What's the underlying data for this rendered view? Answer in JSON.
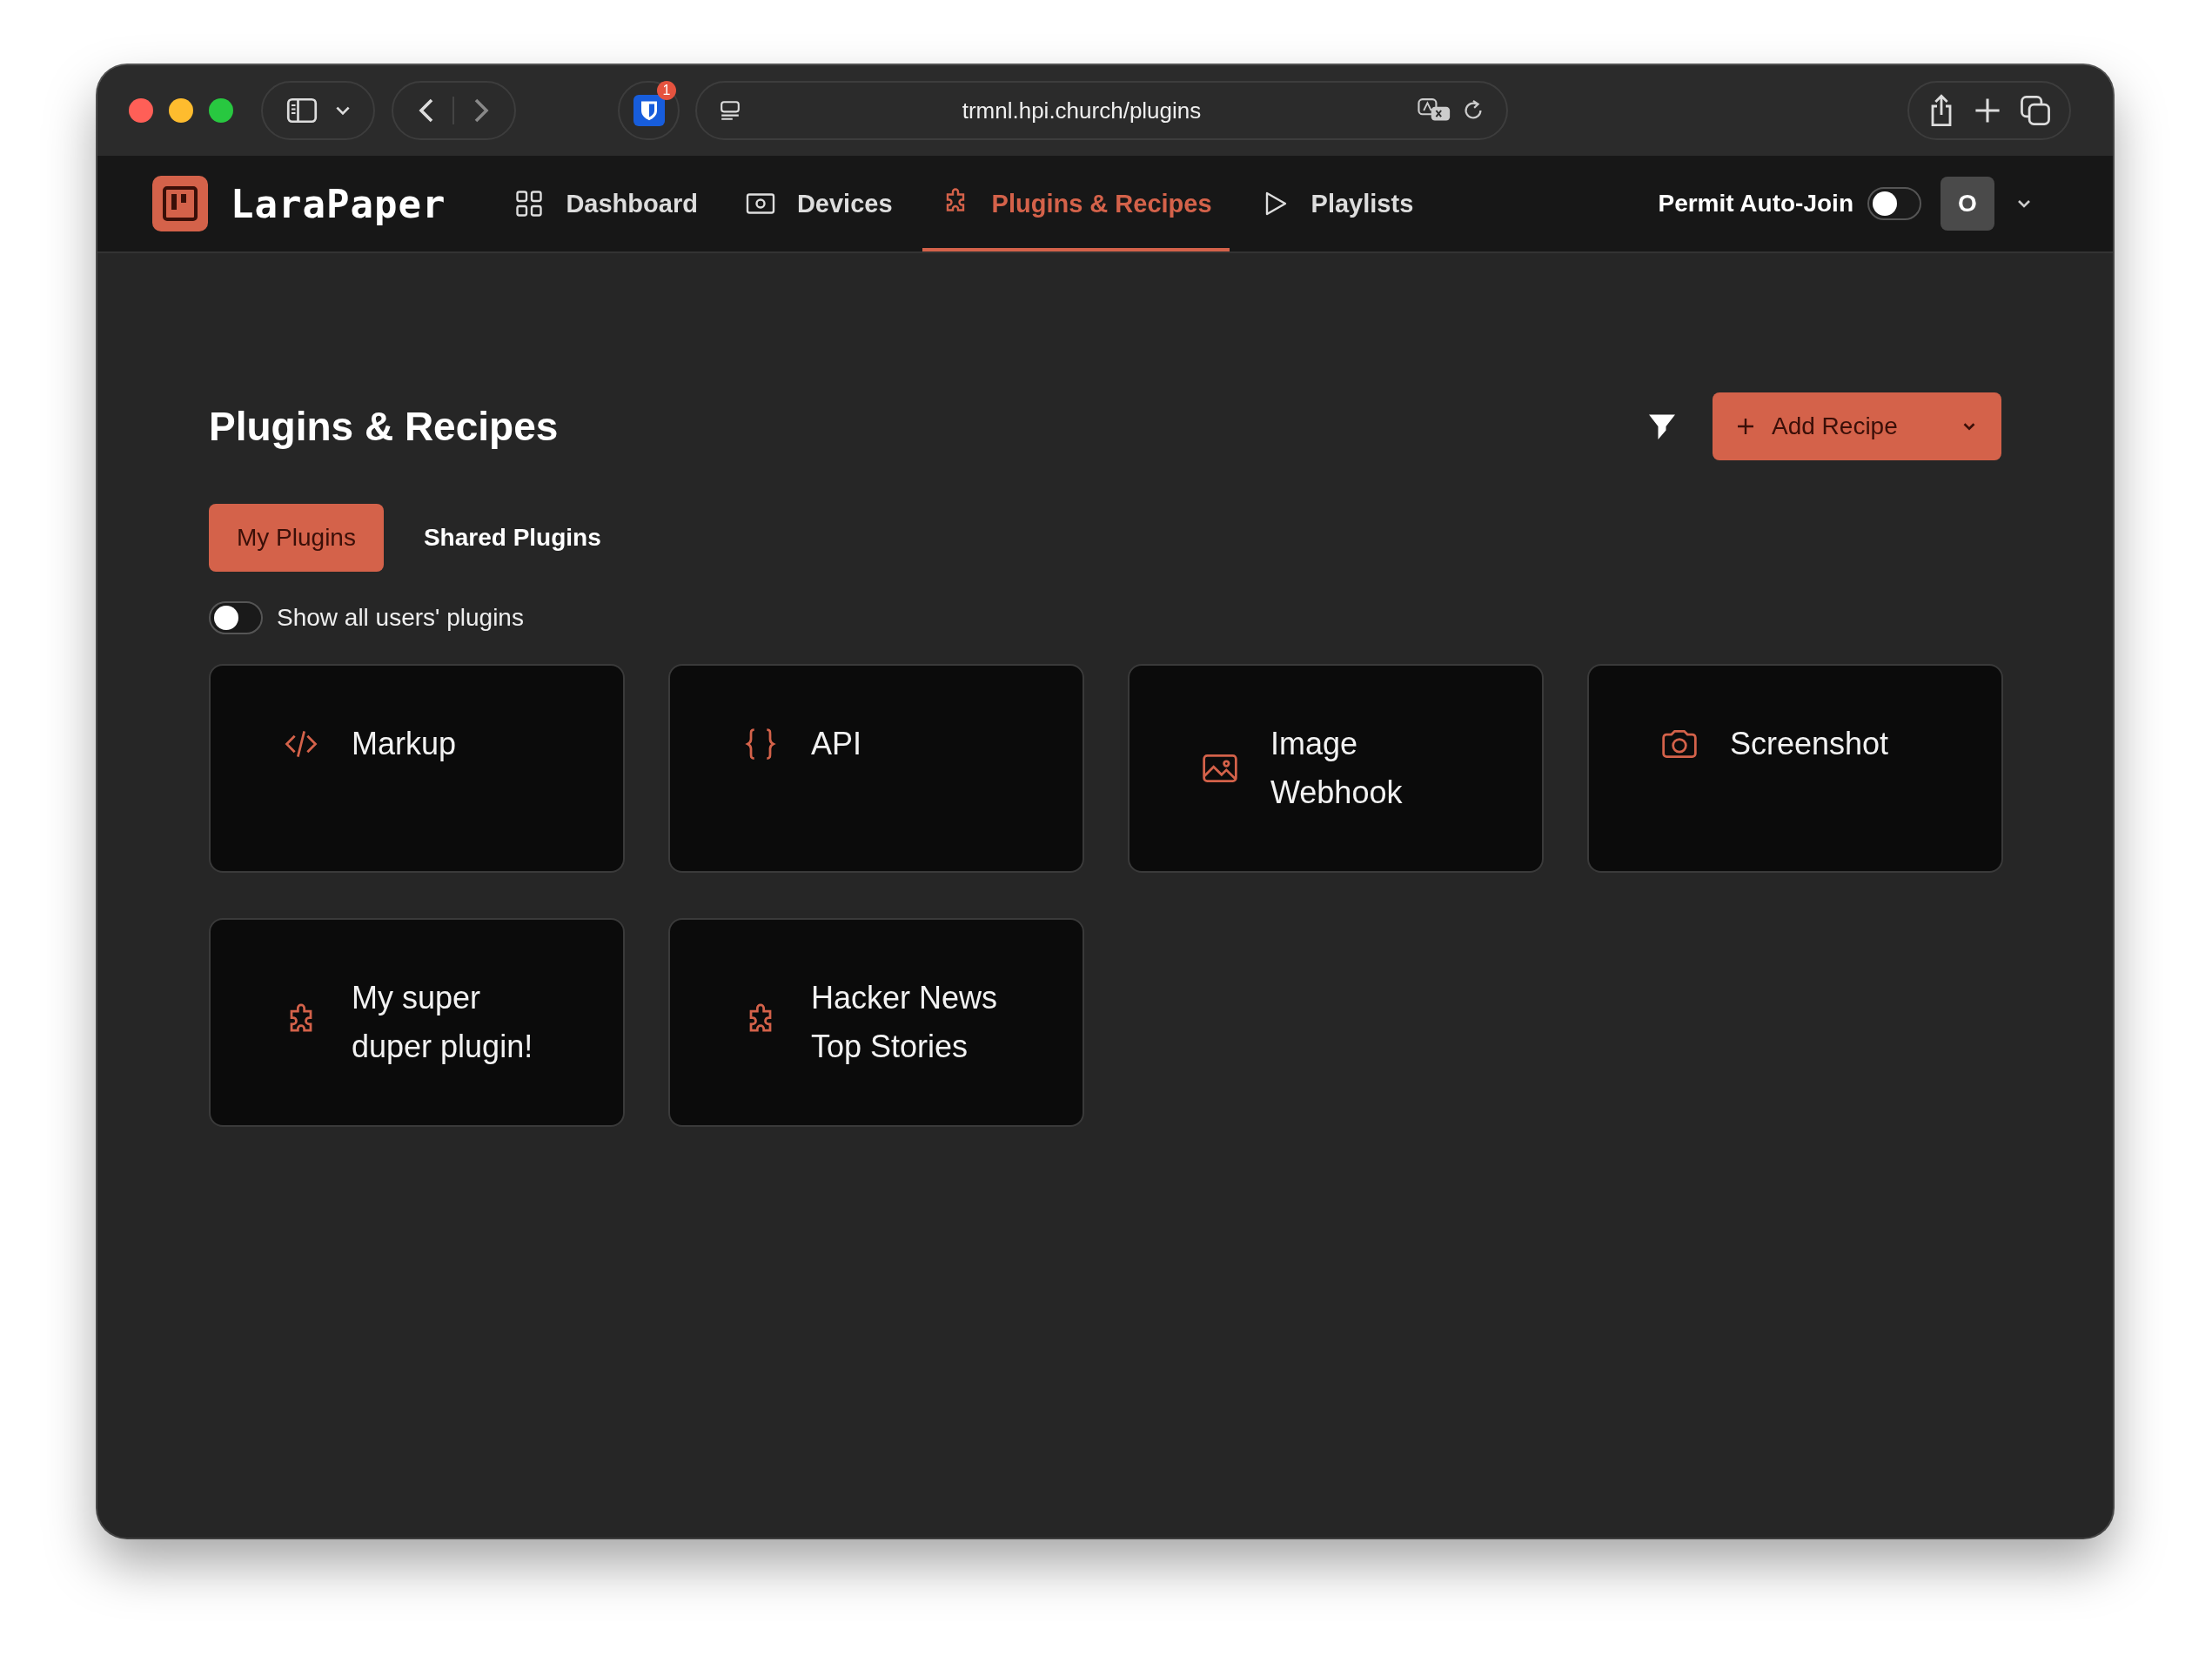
{
  "browser": {
    "url": "trmnl.hpi.church/plugins",
    "extension_badge": "1"
  },
  "app": {
    "brand": "LaraPaper",
    "nav": [
      {
        "label": "Dashboard",
        "kind": "grid",
        "selected": false
      },
      {
        "label": "Devices",
        "kind": "device",
        "selected": false
      },
      {
        "label": "Plugins & Recipes",
        "kind": "puzzle",
        "selected": true
      },
      {
        "label": "Playlists",
        "kind": "play",
        "selected": false
      }
    ],
    "permit_auto_join": {
      "label": "Permit Auto-Join",
      "on": false
    },
    "avatar": "O"
  },
  "page": {
    "title": "Plugins & Recipes",
    "add_button": "Add Recipe",
    "tabs": [
      {
        "label": "My Plugins",
        "selected": true
      },
      {
        "label": "Shared Plugins",
        "selected": false
      }
    ],
    "show_all": {
      "label": "Show all users' plugins",
      "on": false
    },
    "plugins": [
      {
        "name": "Markup",
        "kind": "code"
      },
      {
        "name": "API",
        "kind": "braces"
      },
      {
        "name": "Image Webhook",
        "kind": "image"
      },
      {
        "name": "Screenshot",
        "kind": "camera"
      },
      {
        "name": "My super duper plugin!",
        "kind": "puzzle"
      },
      {
        "name": "Hacker News Top Stories",
        "kind": "puzzle"
      }
    ]
  }
}
